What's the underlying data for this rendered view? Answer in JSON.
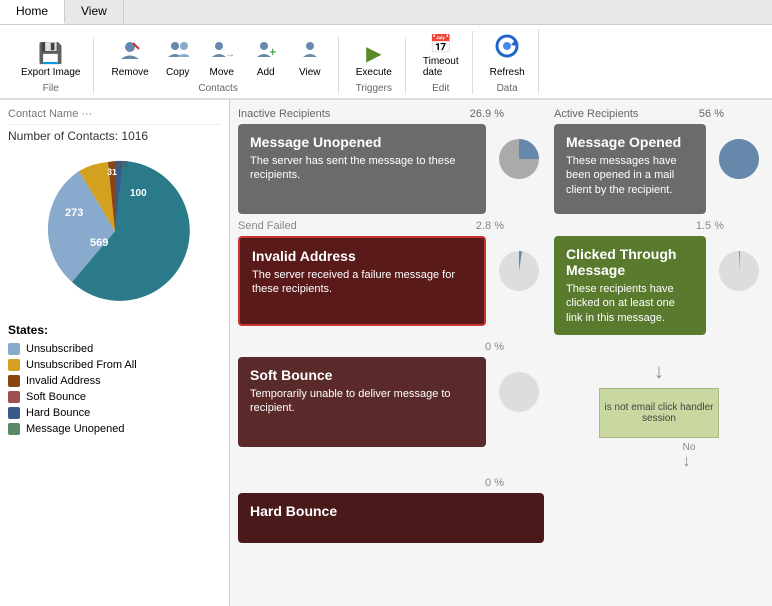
{
  "tabs": [
    {
      "label": "Home",
      "active": true
    },
    {
      "label": "View",
      "active": false
    }
  ],
  "ribbon": {
    "file_group": {
      "label": "File",
      "buttons": [
        {
          "id": "export-image",
          "icon": "💾",
          "label": "Export\nImage"
        }
      ]
    },
    "contacts_group": {
      "label": "Contacts",
      "buttons": [
        {
          "id": "remove",
          "icon": "👤",
          "label": "Remove"
        },
        {
          "id": "copy",
          "icon": "👤",
          "label": "Copy"
        },
        {
          "id": "move",
          "icon": "👤",
          "label": "Move"
        },
        {
          "id": "add",
          "icon": "👤",
          "label": "Add"
        },
        {
          "id": "view",
          "icon": "👤",
          "label": "View"
        }
      ]
    },
    "triggers_group": {
      "label": "Triggers",
      "buttons": [
        {
          "id": "execute",
          "icon": "▶",
          "label": "Execute"
        }
      ]
    },
    "edit_group": {
      "label": "Edit",
      "buttons": [
        {
          "id": "timeout-date",
          "icon": "📅",
          "label": "Timeout\ndate"
        }
      ]
    },
    "data_group": {
      "label": "Data",
      "buttons": [
        {
          "id": "refresh",
          "icon": "🔄",
          "label": "Refresh"
        }
      ]
    }
  },
  "left_panel": {
    "contact_name": "Contact Name ···",
    "contacts_label": "Number of Contacts:",
    "contacts_count": "1016",
    "chart": {
      "segments": [
        {
          "value": 569,
          "color": "#2a7a8a",
          "label": "569"
        },
        {
          "value": 273,
          "color": "#88aacc",
          "label": "273"
        },
        {
          "value": 100,
          "color": "#d4a020",
          "label": "100"
        },
        {
          "value": 31,
          "color": "#8b4513",
          "label": "31"
        },
        {
          "value": 28,
          "color": "#a0a0a0",
          "label": "28"
        },
        {
          "value": 15,
          "color": "#3a5a8a",
          "label": "15"
        }
      ]
    },
    "states_title": "States:",
    "legend": [
      {
        "color": "#88aacc",
        "label": "Unsubscribed"
      },
      {
        "color": "#d4a020",
        "label": "Unsubscribed From All"
      },
      {
        "color": "#8b4513",
        "label": "Invalid Address"
      },
      {
        "color": "#a05050",
        "label": "Soft Bounce"
      },
      {
        "color": "#3a5a8a",
        "label": "Hard Bounce"
      },
      {
        "color": "#5a8a6a",
        "label": "Message Unopened"
      }
    ]
  },
  "right_panel": {
    "inactive_section": "Inactive Recipients",
    "active_section": "Active Recipients",
    "send_failed_section": "Send Failed",
    "cards": {
      "message_unopened": {
        "percent": "26.9 %",
        "title": "Message Unopened",
        "desc": "The server has sent the message to these recipients."
      },
      "message_opened": {
        "percent": "56 %",
        "title": "Message Opened",
        "desc": "These messages have been opened in a mail client by the recipient."
      },
      "invalid_address": {
        "percent": "2.8 %",
        "title": "Invalid Address",
        "desc": "The server received a failure message for these recipients."
      },
      "clicked_through": {
        "percent": "1.5 %",
        "title": "Clicked Through Message",
        "desc": "These recipients have clicked on at least one link in this message."
      },
      "soft_bounce": {
        "percent": "0 %",
        "title": "Soft Bounce",
        "desc": "Temporarily unable to deliver message to recipient."
      },
      "hard_bounce": {
        "percent": "0 %",
        "title": "Hard Bounce",
        "desc": ""
      }
    },
    "flow": {
      "diamond_text": "is not email click handler session",
      "no_label": "No"
    }
  }
}
